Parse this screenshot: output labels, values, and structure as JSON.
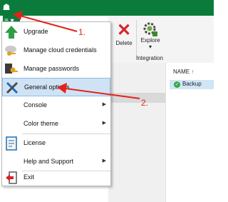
{
  "toolbar": {
    "delete_label": "Delete",
    "explore_label": "Explore",
    "group_label": "Integration"
  },
  "list": {
    "column_header": "NAME",
    "sort_arrow": "↑",
    "rows": [
      {
        "label": "Backup"
      }
    ]
  },
  "menu": {
    "items": [
      {
        "label": "Upgrade",
        "icon": "upgrade-arrow-icon"
      },
      {
        "label": "Manage cloud credentials",
        "icon": "cloud-key-icon"
      },
      {
        "label": "Manage passwords",
        "icon": "password-key-icon"
      },
      {
        "label": "General options",
        "icon": "tools-icon"
      },
      {
        "label": "Console",
        "has_submenu": true
      },
      {
        "label": "Color theme",
        "has_submenu": true
      },
      {
        "label": "License",
        "icon": "license-icon"
      },
      {
        "label": "Help and Support",
        "has_submenu": true
      },
      {
        "label": "Exit",
        "icon": "exit-icon"
      }
    ],
    "selected": "General options",
    "submenu_glyph": "▶"
  },
  "annotations": {
    "step1": "1.",
    "step2": "2."
  },
  "colors": {
    "titlebar": "#0b7b3c",
    "selection": "#cfe3f5",
    "annotation": "#e2231a",
    "upgrade_green": "#2e9e46"
  }
}
